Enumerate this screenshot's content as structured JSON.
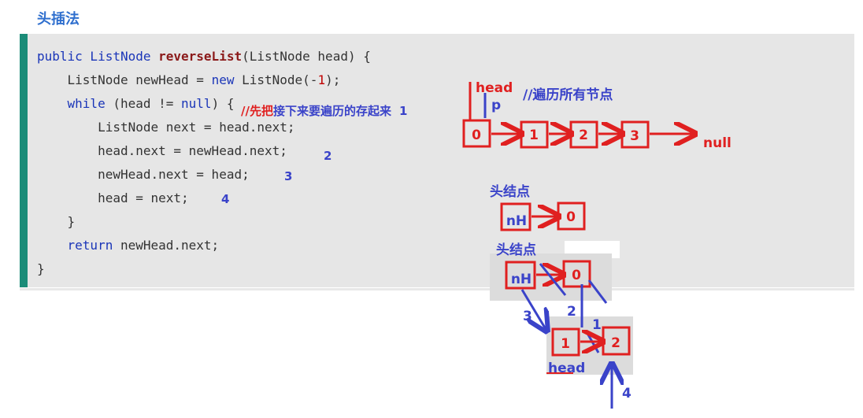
{
  "heading": "头插法",
  "code": {
    "line1_a": "public ListNode ",
    "line1_fn": "reverseList",
    "line1_b": "(ListNode head) {",
    "line2_a": "    ListNode newHead = ",
    "line2_kw": "new",
    "line2_b": " ListNode(-",
    "line2_num": "1",
    "line2_c": ");",
    "line3_kw": "while",
    "line3_b": " (head != ",
    "line3_kw2": "null",
    "line3_c": ") {",
    "line4": "        ListNode next = head.next;",
    "line5": "        head.next = newHead.next;",
    "line6": "        newHead.next = head;",
    "line7": "        head = next;",
    "line8": "    }",
    "line9_kw": "return",
    "line9_b": " newHead.next;",
    "line10": "}"
  },
  "annotations": {
    "comment_red": "//先把",
    "comment_blue": "接下来要遍历的存起来",
    "step1": "1",
    "step2": "2",
    "step3": "3",
    "step4": "4",
    "traverse_comment": "//遍历所有节点",
    "head_label": "head",
    "p_label": "p",
    "null_label": "null",
    "head_node_label_1": "头结点",
    "head_node_label_2": "头结点",
    "head_label_bottom": "head",
    "diag_step1": "1",
    "diag_step2": "2",
    "diag_step3": "3",
    "diag_step4": "4"
  },
  "list_top": {
    "nodes": [
      "0",
      "1",
      "2",
      "3"
    ]
  },
  "diagram_middle": {
    "nh": "nH",
    "node": "0"
  },
  "diagram_bottom": {
    "nh": "nH",
    "node0": "0",
    "node1": "1",
    "node2": "2"
  },
  "colors": {
    "accent_bar": "#1b8c78",
    "red": "#e02020",
    "blue": "#3a43c9"
  }
}
